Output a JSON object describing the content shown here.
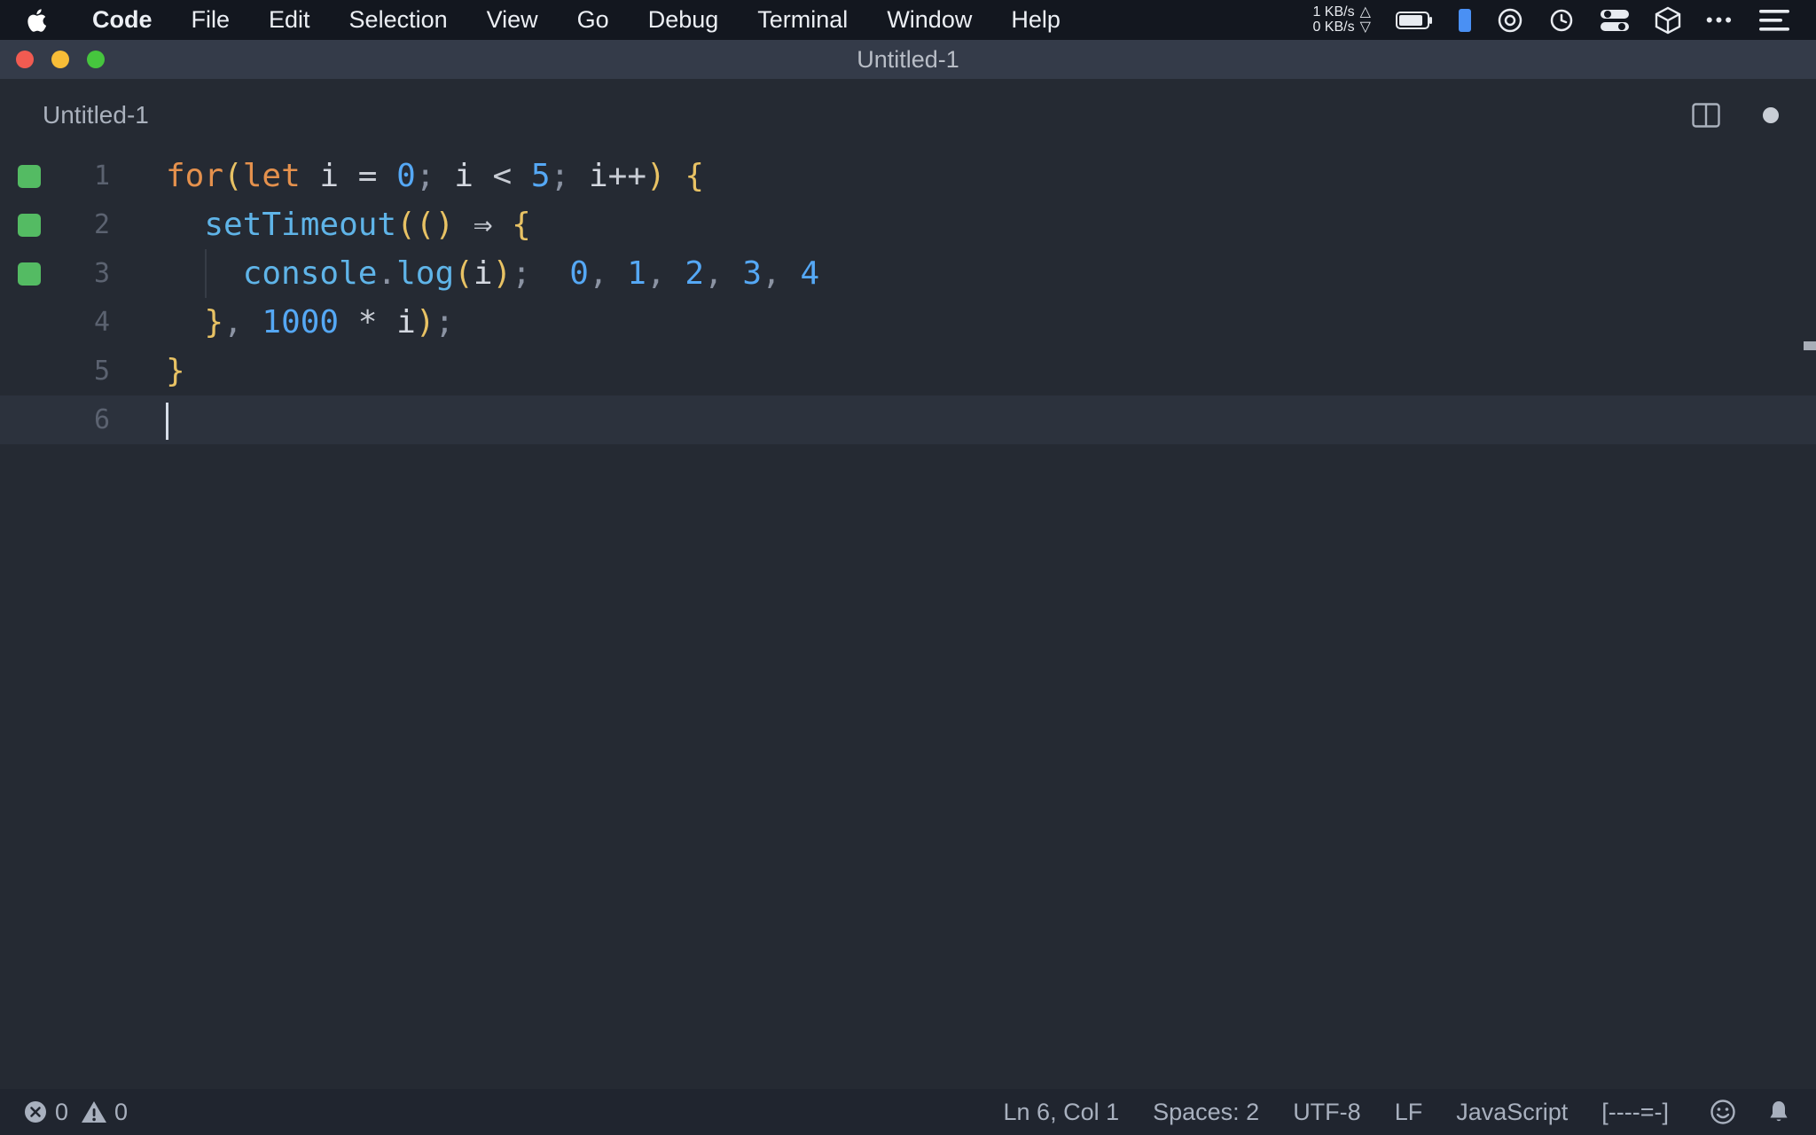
{
  "menubar": {
    "items": [
      "Code",
      "File",
      "Edit",
      "Selection",
      "View",
      "Go",
      "Debug",
      "Terminal",
      "Window",
      "Help"
    ],
    "net_up": "1 KB/s",
    "net_down": "0 KB/s",
    "up_arrow": "△",
    "down_arrow": "▽",
    "ellipsis": "•••"
  },
  "titlebar": {
    "title": "Untitled-1"
  },
  "tabbar": {
    "filename": "Untitled-1"
  },
  "editor": {
    "language_hint": "javascript",
    "lines": [
      {
        "num": "1",
        "marker": true,
        "tokens": [
          [
            "kw",
            "for"
          ],
          [
            "br",
            "("
          ],
          [
            "kw",
            "let"
          ],
          [
            "pl",
            " i "
          ],
          [
            "op",
            "= "
          ],
          [
            "num",
            "0"
          ],
          [
            "pu",
            "; "
          ],
          [
            "pl",
            "i "
          ],
          [
            "op",
            "< "
          ],
          [
            "num",
            "5"
          ],
          [
            "pu",
            "; "
          ],
          [
            "pl",
            "i"
          ],
          [
            "op",
            "++"
          ],
          [
            "br",
            ") "
          ],
          [
            "br",
            "{"
          ]
        ]
      },
      {
        "num": "2",
        "marker": true,
        "tokens": [
          [
            "pl",
            "  "
          ],
          [
            "fn",
            "setTimeout"
          ],
          [
            "br",
            "(() "
          ],
          [
            "op",
            "⇒ "
          ],
          [
            "br",
            "{"
          ]
        ]
      },
      {
        "num": "3",
        "marker": true,
        "guide": true,
        "tokens": [
          [
            "pl",
            "    "
          ],
          [
            "fn",
            "console"
          ],
          [
            "pu",
            "."
          ],
          [
            "fn",
            "log"
          ],
          [
            "br",
            "("
          ],
          [
            "pl",
            "i"
          ],
          [
            "br",
            ")"
          ],
          [
            "pu",
            ";"
          ],
          [
            "pl",
            "  "
          ],
          [
            "num",
            "0"
          ],
          [
            "pu",
            ", "
          ],
          [
            "num",
            "1"
          ],
          [
            "pu",
            ", "
          ],
          [
            "num",
            "2"
          ],
          [
            "pu",
            ", "
          ],
          [
            "num",
            "3"
          ],
          [
            "pu",
            ", "
          ],
          [
            "num",
            "4"
          ]
        ]
      },
      {
        "num": "4",
        "tokens": [
          [
            "pl",
            "  "
          ],
          [
            "br",
            "}"
          ],
          [
            "pu",
            ", "
          ],
          [
            "num",
            "1000"
          ],
          [
            "op",
            " * "
          ],
          [
            "pl",
            "i"
          ],
          [
            "br",
            ")"
          ],
          [
            "pu",
            ";"
          ]
        ]
      },
      {
        "num": "5",
        "tokens": [
          [
            "br",
            "}"
          ]
        ]
      },
      {
        "num": "6",
        "current": true,
        "cursor": true,
        "tokens": []
      }
    ]
  },
  "statusbar": {
    "errors": "0",
    "warnings": "0",
    "items": [
      "Ln 6, Col 1",
      "Spaces: 2",
      "UTF-8",
      "LF",
      "JavaScript",
      "[----=-]"
    ]
  },
  "colors": {
    "keyword": "#e5914d",
    "number": "#55a8f5",
    "function": "#5fb4e8",
    "brace": "#e8c264",
    "gutter_marker": "#54bb63",
    "editor_bg": "#252a33",
    "menubar_bg": "#13171f",
    "titlebar_bg": "#343b49",
    "statusbar_bg": "#20252f",
    "traffic_red": "#f15b51",
    "traffic_yellow": "#f8bd37",
    "traffic_green": "#46c53e"
  }
}
